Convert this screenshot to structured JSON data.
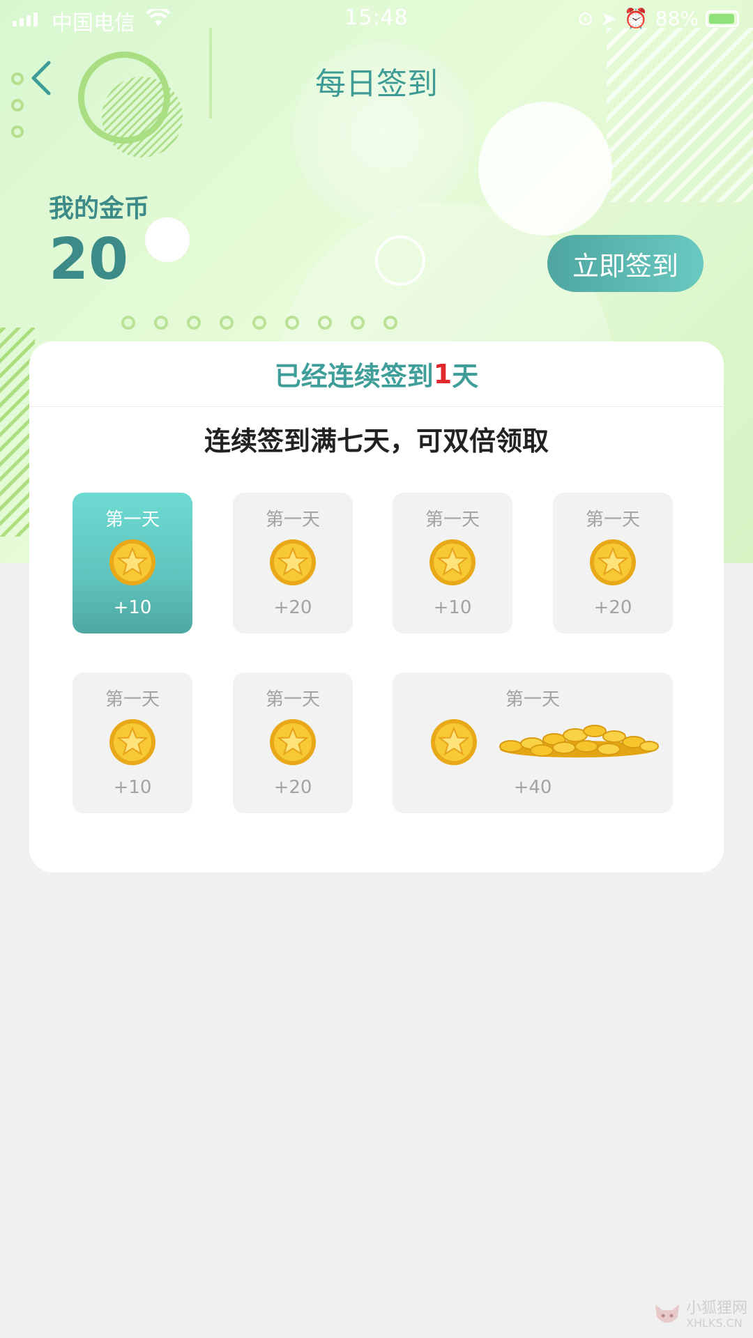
{
  "status_bar": {
    "carrier": "中国电信",
    "time": "15:48",
    "battery": "88%"
  },
  "nav": {
    "title": "每日签到"
  },
  "coins": {
    "label": "我的金币",
    "value": "20"
  },
  "signin_button": {
    "label": "立即签到"
  },
  "card": {
    "streak_prefix": "已经连续签到",
    "streak_days": "1",
    "streak_suffix": "天",
    "tip": "连续签到满七天，可双倍领取",
    "days": [
      {
        "label": "第一天",
        "amount": "+10",
        "active": true
      },
      {
        "label": "第一天",
        "amount": "+20",
        "active": false
      },
      {
        "label": "第一天",
        "amount": "+10",
        "active": false
      },
      {
        "label": "第一天",
        "amount": "+20",
        "active": false
      },
      {
        "label": "第一天",
        "amount": "+10",
        "active": false
      },
      {
        "label": "第一天",
        "amount": "+20",
        "active": false
      },
      {
        "label": "第一天",
        "amount": "+40",
        "active": false
      }
    ]
  },
  "watermark": {
    "main": "小狐狸网",
    "sub": "XHLKS.CN"
  },
  "colors": {
    "accent": "#4fa6a1",
    "streak_number": "#e0292b",
    "coin_gold": "#f2b71f"
  }
}
